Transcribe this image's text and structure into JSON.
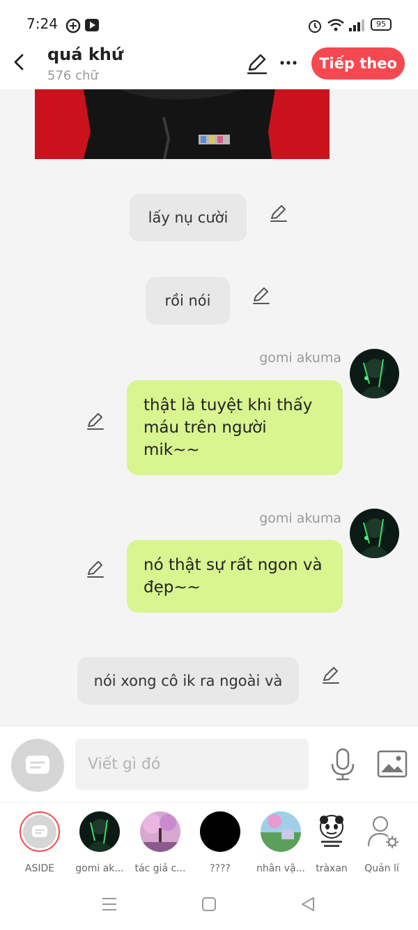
{
  "status_bar": {
    "time": "7:24",
    "battery": "95"
  },
  "header": {
    "title": "quá khứ",
    "subtitle": "576 chữ",
    "next_label": "Tiếp theo"
  },
  "messages": [
    {
      "type": "narration",
      "text": "lấy nụ cười"
    },
    {
      "type": "narration",
      "text": "rồi nói"
    },
    {
      "type": "character",
      "author": "gomi akuma",
      "text": "thật là tuyệt khi thấy máu trên người mik~~"
    },
    {
      "type": "character",
      "author": "gomi akuma",
      "text": "nó thật sự rất ngon và đẹp~~"
    },
    {
      "type": "narration",
      "text": "nói xong cô ik ra ngoài và"
    }
  ],
  "composer": {
    "placeholder": "Viết gì đó"
  },
  "characters": [
    {
      "label": "ASIDE",
      "icon": "aside-icon"
    },
    {
      "label": "gomi ak...",
      "icon": "avatar-dark-green"
    },
    {
      "label": "tác giả c...",
      "icon": "avatar-pink-tree"
    },
    {
      "label": "????",
      "icon": "avatar-black"
    },
    {
      "label": "nhân vậ...",
      "icon": "avatar-landscape"
    },
    {
      "label": "tràxan",
      "icon": "avatar-panda-meme"
    },
    {
      "label": "Quản lí",
      "icon": "manage-user-icon"
    }
  ],
  "colors": {
    "accent": "#f64850",
    "bubble": "#d8f58f",
    "narration": "#e8e8e8"
  }
}
